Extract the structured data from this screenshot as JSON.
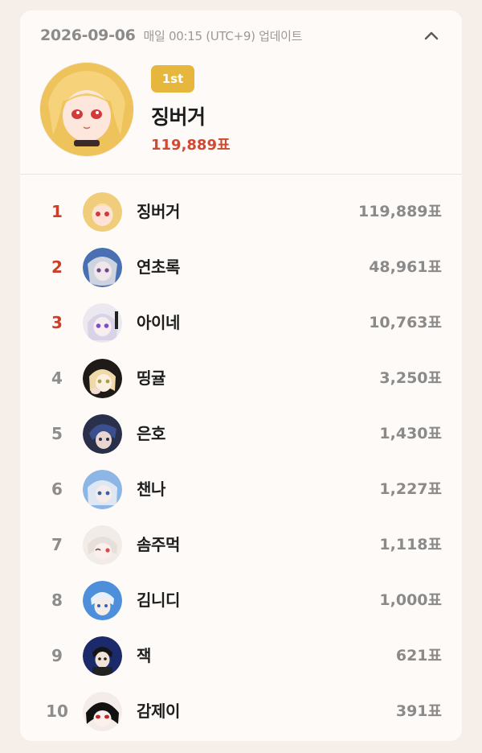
{
  "header": {
    "date": "2026-09-06",
    "update_text": "매일 00:15 (UTC+9) 업데이트",
    "toggle_icon": "chevron-up-icon"
  },
  "top": {
    "badge": "1st",
    "name": "징버거",
    "votes": "119,889표",
    "avatar_colors": [
      "#eec25b",
      "#ffe5db"
    ]
  },
  "ranking": [
    {
      "rank": "1",
      "name": "징버거",
      "votes": "119,889표",
      "avatar_colors": [
        "#f0cd7a",
        "#ffe2d6"
      ]
    },
    {
      "rank": "2",
      "name": "연초록",
      "votes": "48,961표",
      "avatar_colors": [
        "#4a6fb3",
        "#e9e4ea"
      ]
    },
    {
      "rank": "3",
      "name": "아이네",
      "votes": "10,763표",
      "avatar_colors": [
        "#d9d3e6",
        "#7d4fc2"
      ]
    },
    {
      "rank": "4",
      "name": "띵귤",
      "votes": "3,250표",
      "avatar_colors": [
        "#1e1a18",
        "#f0d9a8"
      ]
    },
    {
      "rank": "5",
      "name": "은호",
      "votes": "1,430표",
      "avatar_colors": [
        "#3b4f8f",
        "#2a2f4a"
      ]
    },
    {
      "rank": "6",
      "name": "챈나",
      "votes": "1,227표",
      "avatar_colors": [
        "#8db5e6",
        "#e8eef7"
      ]
    },
    {
      "rank": "7",
      "name": "솜주먹",
      "votes": "1,118표",
      "avatar_colors": [
        "#f1ece8",
        "#d84a4a"
      ]
    },
    {
      "rank": "8",
      "name": "김니디",
      "votes": "1,000표",
      "avatar_colors": [
        "#4e8fdc",
        "#e7f0fb"
      ]
    },
    {
      "rank": "9",
      "name": "잭",
      "votes": "621표",
      "avatar_colors": [
        "#1b2a6b",
        "#f1e2d6"
      ]
    },
    {
      "rank": "10",
      "name": "감제이",
      "votes": "391표",
      "avatar_colors": [
        "#f3ece9",
        "#111111"
      ]
    }
  ],
  "colors": {
    "accent_red": "#cc3e2a",
    "badge_gold": "#e7b63c"
  }
}
